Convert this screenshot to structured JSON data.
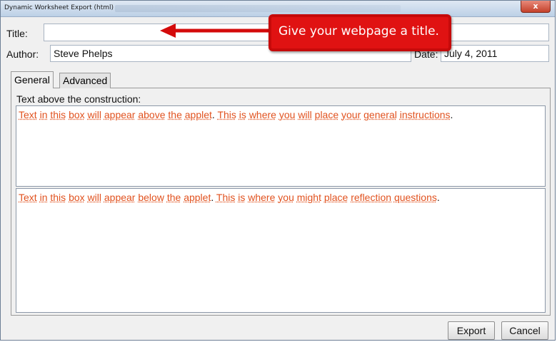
{
  "window": {
    "title": "Dynamic Worksheet Export (html)",
    "close_glyph": "x"
  },
  "form": {
    "title_label": "Title:",
    "title_value": "",
    "author_label": "Author:",
    "author_value": "Steve Phelps",
    "date_label": "Date:",
    "date_value": "July 4, 2011"
  },
  "tabs": [
    {
      "label": "General",
      "active": true
    },
    {
      "label": "Advanced",
      "active": false
    }
  ],
  "general": {
    "above_label": "Text above the construction:",
    "above_text": "Text in this box will appear above the applet. This is where you will place your general instructions.",
    "below_text": "Text in this box will appear below the applet. This is where you might place reflection questions."
  },
  "buttons": {
    "export": "Export",
    "cancel": "Cancel"
  },
  "annotation": {
    "text": "Give your webpage a title.",
    "color": "#e01212"
  },
  "colors": {
    "spellcheck_text": "#e1521f"
  },
  "icons": [
    "close-icon",
    "arrow-left-icon"
  ]
}
